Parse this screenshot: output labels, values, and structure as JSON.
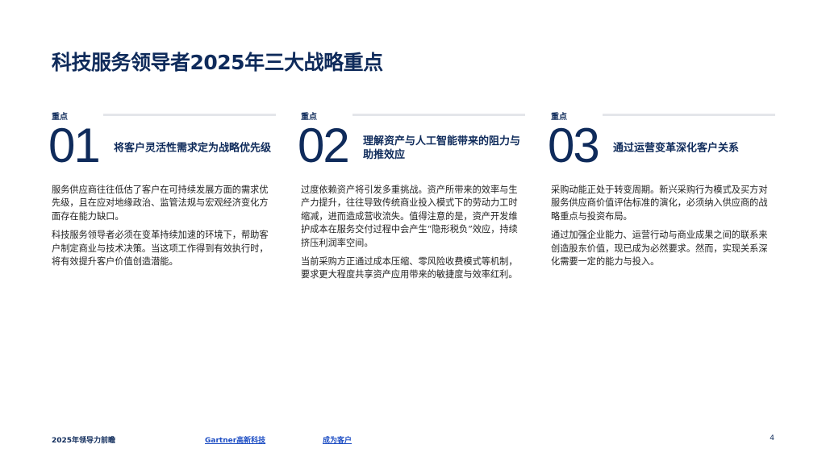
{
  "title": "科技服务领导者2025年三大战略重点",
  "focus_areas": [
    {
      "kicker": "重点",
      "number": "01",
      "heading": "将客户灵活性需求定为战略优先级",
      "paragraphs": [
        "服务供应商往往低估了客户在可持续发展方面的需求优先级，且在应对地缘政治、监管法规与宏观经济变化方面存在能力缺口。",
        "科技服务领导者必须在变革持续加速的环境下，帮助客户制定商业与技术决策。当这项工作得到有效执行时，将有效提升客户价值创造潜能。"
      ]
    },
    {
      "kicker": "重点",
      "number": "02",
      "heading": "理解资产与人工智能带来的阻力与助推效应",
      "paragraphs": [
        "过度依赖资产将引发多重挑战。资产所带来的效率与生产力提升，往往导致传统商业投入模式下的劳动力工时缩减，进而造成营收流失。值得注意的是，资产开发维护成本在服务交付过程中会产生“隐形税负”效应，持续挤压利润率空间。",
        "当前采购方正通过成本压缩、零风险收费模式等机制，要求更大程度共享资产应用带来的敏捷度与效率红利。"
      ]
    },
    {
      "kicker": "重点",
      "number": "03",
      "heading": "通过运营变革深化客户关系",
      "paragraphs": [
        "采购动能正处于转变周期。新兴采购行为模式及买方对服务供应商价值评估标准的演化，必须纳入供应商的战略重点与投资布局。",
        "通过加强企业能力、运营行动与商业成果之间的联系来创造股东价值，现已成为必然要求。然而，实现关系深化需要一定的能力与投入。"
      ]
    }
  ],
  "footer": {
    "left": "2025年领导力前瞻",
    "link_1": "Gartner高新科技",
    "link_2": "成为客户",
    "page_number": "4"
  }
}
